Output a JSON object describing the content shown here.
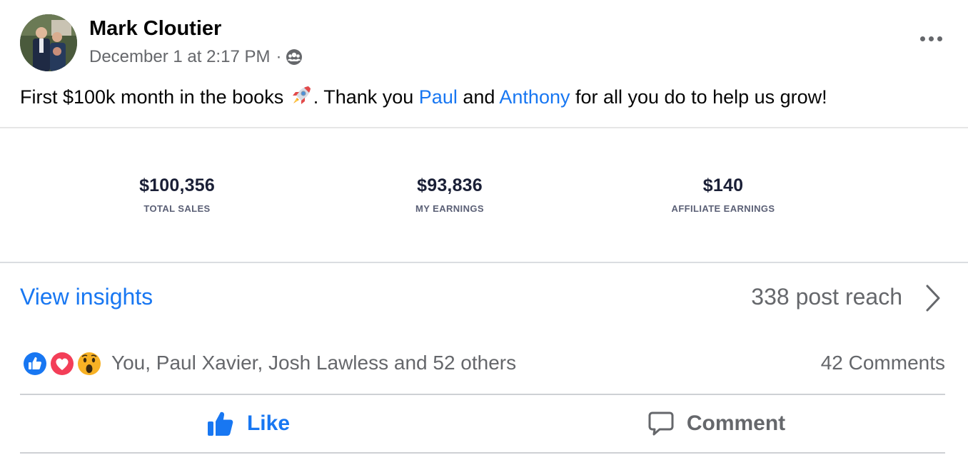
{
  "post": {
    "author": "Mark Cloutier",
    "timestamp": "December 1 at 2:17 PM",
    "separator": "·",
    "audience_icon": "group-audience-icon",
    "more_icon": "more-options-icon",
    "text": {
      "part1": "First $100k month in the books ",
      "rocket_icon": "rocket-emoji-icon",
      "part2": ". Thank you ",
      "mention1": "Paul",
      "part3": " and ",
      "mention2": "Anthony",
      "part4": " for all you do to help us grow!"
    }
  },
  "stats": [
    {
      "value": "$100,356",
      "label": "TOTAL SALES"
    },
    {
      "value": "$93,836",
      "label": "MY EARNINGS"
    },
    {
      "value": "$140",
      "label": "AFFILIATE EARNINGS"
    }
  ],
  "insights": {
    "view_label": "View insights",
    "reach": "338 post reach",
    "chevron_icon": "chevron-right-icon"
  },
  "reactions": {
    "icons": [
      "like-reaction-icon",
      "love-reaction-icon",
      "wow-reaction-icon"
    ],
    "summary": "You, Paul Xavier, Josh Lawless and 52 others",
    "comments": "42 Comments"
  },
  "actions": {
    "like_label": "Like",
    "comment_label": "Comment"
  },
  "colors": {
    "link_blue": "#1877f2",
    "secondary_text": "#65676b",
    "love_red": "#f33e58",
    "wow_yellow": "#f7b125"
  }
}
